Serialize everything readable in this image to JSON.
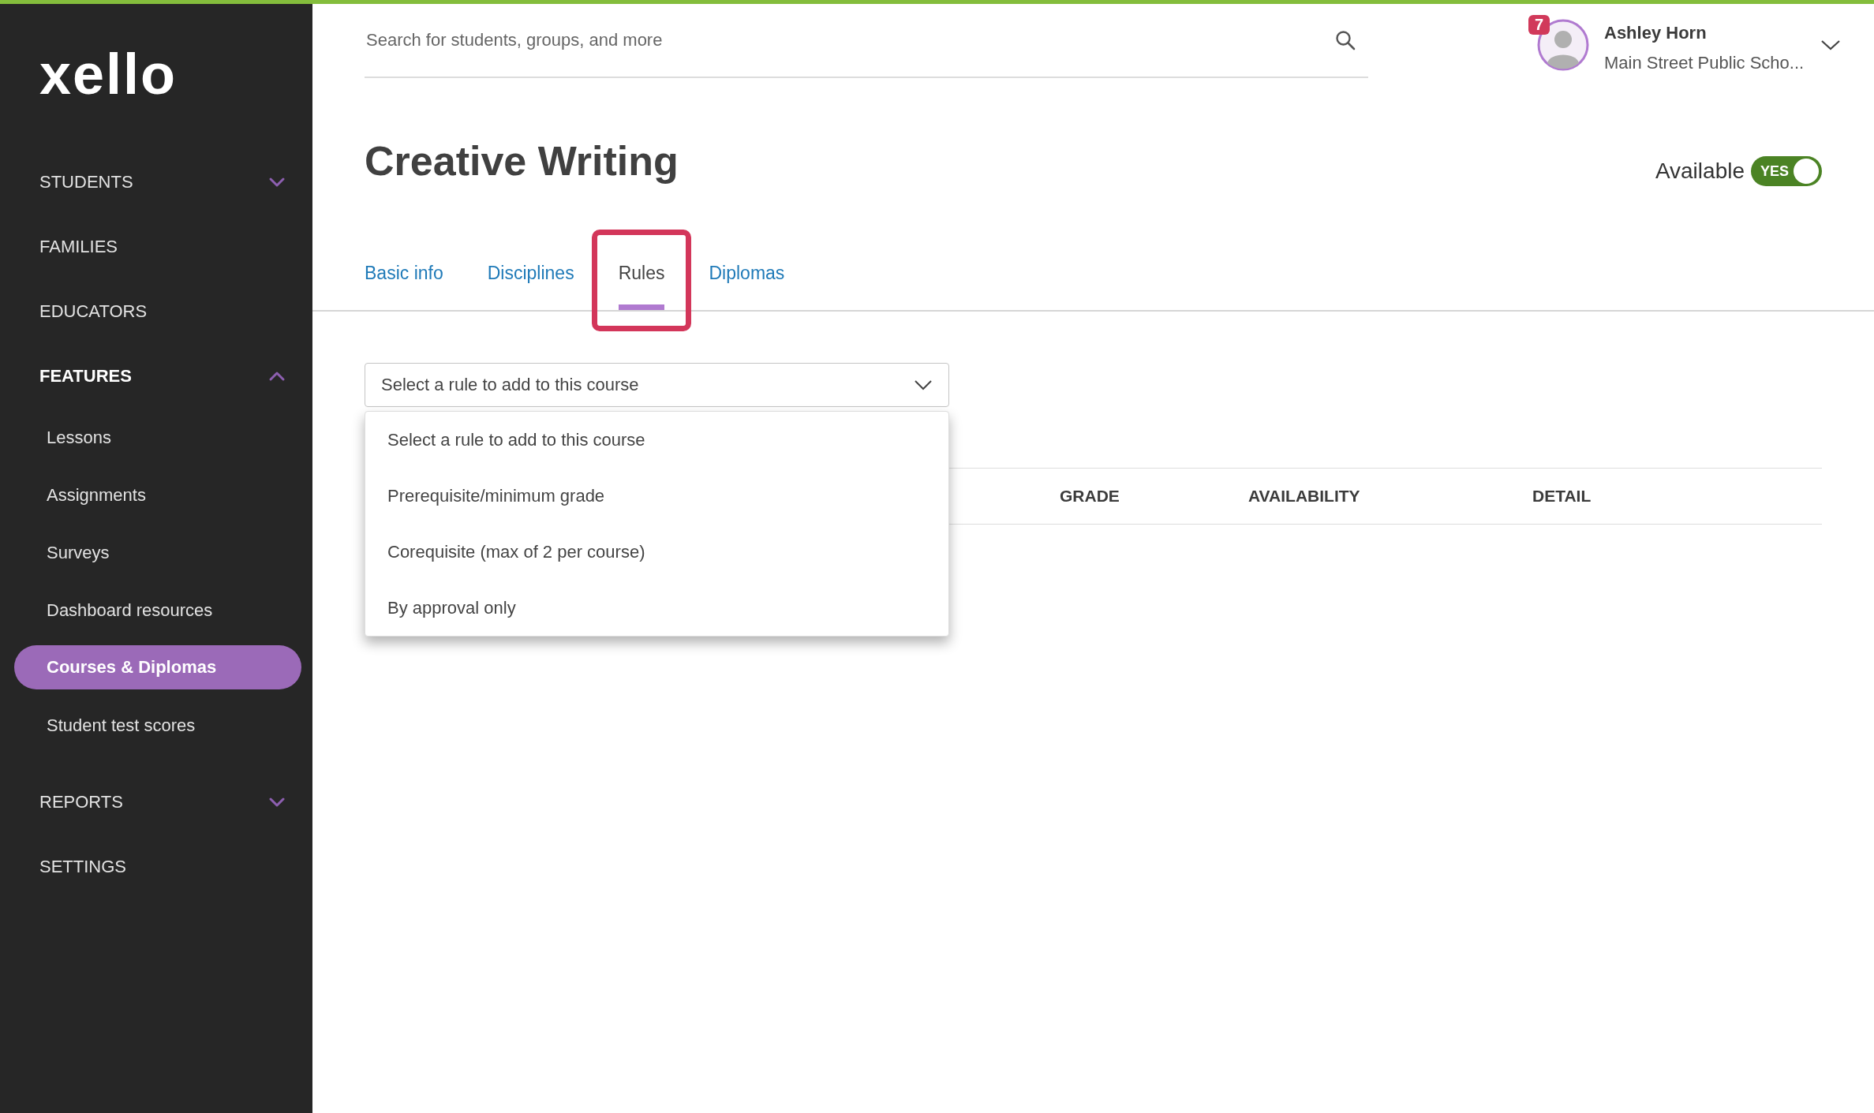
{
  "logo": {
    "text": "xello"
  },
  "sidebar": {
    "items": [
      {
        "label": "STUDENTS",
        "kind": "group",
        "expanded": false,
        "selected": false
      },
      {
        "label": "FAMILIES",
        "kind": "link",
        "selected": false
      },
      {
        "label": "EDUCATORS",
        "kind": "link",
        "selected": false
      },
      {
        "label": "FEATURES",
        "kind": "group",
        "expanded": true,
        "selected": false
      },
      {
        "label": "Lessons",
        "kind": "sub",
        "selected": false
      },
      {
        "label": "Assignments",
        "kind": "sub",
        "selected": false
      },
      {
        "label": "Surveys",
        "kind": "sub",
        "selected": false
      },
      {
        "label": "Dashboard resources",
        "kind": "sub",
        "selected": false
      },
      {
        "label": "Courses & Diplomas",
        "kind": "sub",
        "selected": true
      },
      {
        "label": "Student test scores",
        "kind": "sub",
        "selected": false
      },
      {
        "label": "REPORTS",
        "kind": "group",
        "expanded": false,
        "selected": false
      },
      {
        "label": "SETTINGS",
        "kind": "link",
        "selected": false
      }
    ]
  },
  "search": {
    "placeholder": "Search for students, groups, and more"
  },
  "user": {
    "name": "Ashley Horn",
    "school": "Main Street Public Scho...",
    "badge": "7"
  },
  "page_title": "Creative Writing",
  "available": {
    "label": "Available",
    "on": true,
    "state_text": "YES"
  },
  "tabs": [
    {
      "label": "Basic info",
      "selected": false,
      "highlighted": false
    },
    {
      "label": "Disciplines",
      "selected": false,
      "highlighted": false
    },
    {
      "label": "Rules",
      "selected": true,
      "highlighted": true
    },
    {
      "label": "Diplomas",
      "selected": false,
      "highlighted": false
    }
  ],
  "rule_select": {
    "value": "Select a rule to add to this course",
    "expanded": true,
    "options": [
      "Select a rule to add to this course",
      "Prerequisite/minimum grade",
      "Corequisite (max of 2 per course)",
      "By approval only"
    ]
  },
  "table": {
    "columns": [
      "GRADE",
      "AVAILABILITY",
      "DETAIL"
    ]
  }
}
